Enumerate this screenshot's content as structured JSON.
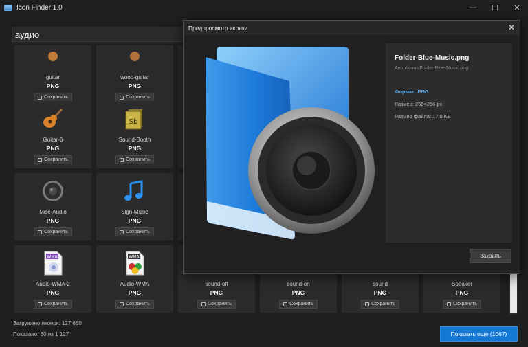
{
  "window": {
    "title": "Icon Finder 1.0",
    "minimize_glyph": "—",
    "maximize_glyph": "☐",
    "close_glyph": "✕"
  },
  "search": {
    "value": "аудио"
  },
  "cards": [
    {
      "name": "guitar",
      "format": "PNG",
      "save_label": "Сохранить",
      "icon": "guitar-icon"
    },
    {
      "name": "wood-guitar",
      "format": "PNG",
      "save_label": "Сохранить",
      "icon": "guitar-icon"
    },
    {
      "name": "Guitar-6",
      "format": "PNG",
      "save_label": "Сохранить",
      "icon": "guitar-icon"
    },
    {
      "name": "Sound-Booth",
      "format": "PNG",
      "save_label": "Сохранить",
      "icon": "soundbooth-icon",
      "badge": "Sb"
    },
    {
      "name": "Misc-Audio",
      "format": "PNG",
      "save_label": "Сохранить",
      "icon": "speaker-icon"
    },
    {
      "name": "Sign-Music",
      "format": "PNG",
      "save_label": "Сохранить",
      "icon": "music-note-icon"
    },
    {
      "name": "Audio-WMA-2",
      "format": "PNG",
      "save_label": "Сохранить",
      "icon": "wma-file-icon",
      "badge": "WMA"
    },
    {
      "name": "Audio-WMA",
      "format": "PNG",
      "save_label": "Сохранить",
      "icon": "wma-file-icon",
      "badge": "WMA"
    },
    {
      "name": "sound-off",
      "format": "PNG",
      "save_label": "Сохранить"
    },
    {
      "name": "sound-on",
      "format": "PNG",
      "save_label": "Сохранить"
    },
    {
      "name": "sound",
      "format": "PNG",
      "save_label": "Сохранить"
    },
    {
      "name": "Speaker",
      "format": "PNG",
      "save_label": "Сохранить"
    }
  ],
  "status": {
    "loaded": "Загружено иконок: 127 660",
    "shown": "Показано: 60 из 1 127"
  },
  "show_more_label": "Показать еще (1067)",
  "dialog": {
    "title": "Предпросмотр иконки",
    "close_glyph": "✕",
    "file_name": "Folder-Blue-Music.png",
    "file_path": "Aeon/icons/Folder-Blue-Music.png",
    "format_line": "Формат: PNG",
    "size_line": "Размер: 256×256 px",
    "bytes_line": "Размер файла: 17,0 KB",
    "close_label": "Закрыть",
    "preview_icon": "folder-blue-music-icon"
  },
  "colors": {
    "accent": "#1478d4",
    "format_text": "#5aa9ec",
    "card_bg": "#2b2b2b"
  }
}
